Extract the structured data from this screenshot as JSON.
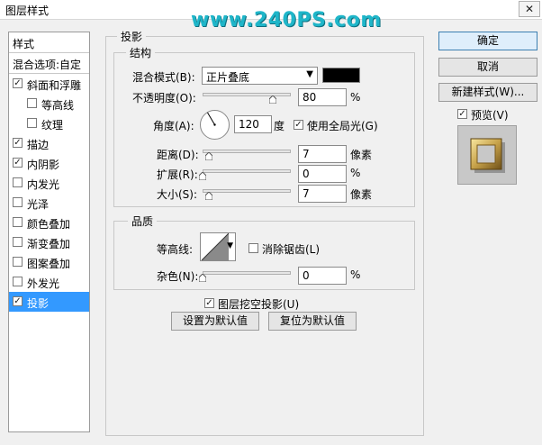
{
  "window": {
    "title": "图层样式",
    "close": "✕",
    "watermark": "www.240PS.com"
  },
  "sidebar": {
    "header": "样式",
    "blend": "混合选项:自定",
    "items": [
      {
        "label": "斜面和浮雕",
        "checked": true
      },
      {
        "label": "等高线",
        "checked": false
      },
      {
        "label": "纹理",
        "checked": false
      },
      {
        "label": "描边",
        "checked": true
      },
      {
        "label": "内阴影",
        "checked": true
      },
      {
        "label": "内发光",
        "checked": false
      },
      {
        "label": "光泽",
        "checked": false
      },
      {
        "label": "颜色叠加",
        "checked": false
      },
      {
        "label": "渐变叠加",
        "checked": false
      },
      {
        "label": "图案叠加",
        "checked": false
      },
      {
        "label": "外发光",
        "checked": false
      },
      {
        "label": "投影",
        "checked": true,
        "selected": true
      }
    ]
  },
  "panel": {
    "title": "投影",
    "structure": {
      "title": "结构",
      "blend_mode_label": "混合模式(B):",
      "blend_mode_value": "正片叠底",
      "shadow_color": "#000000",
      "opacity_label": "不透明度(O):",
      "opacity_value": "80",
      "opacity_unit": "%",
      "opacity_level": 0.8,
      "angle_label": "角度(A):",
      "angle_value": "120",
      "angle_unit": "度",
      "global_light_label": "使用全局光(G)",
      "global_light_checked": true,
      "distance_label": "距离(D):",
      "distance_value": "7",
      "distance_unit": "像素",
      "spread_label": "扩展(R):",
      "spread_value": "0",
      "spread_unit": "%",
      "size_label": "大小(S):",
      "size_value": "7",
      "size_unit": "像素"
    },
    "quality": {
      "title": "品质",
      "contour_label": "等高线:",
      "antialias_label": "消除锯齿(L)",
      "antialias_checked": false,
      "noise_label": "杂色(N):",
      "noise_value": "0",
      "noise_unit": "%"
    },
    "knockout_label": "图层挖空投影(U)",
    "knockout_checked": true,
    "make_default": "设置为默认值",
    "reset_default": "复位为默认值"
  },
  "buttons": {
    "ok": "确定",
    "cancel": "取消",
    "new_style": "新建样式(W)...",
    "preview_label": "预览(V)",
    "preview_checked": true
  }
}
